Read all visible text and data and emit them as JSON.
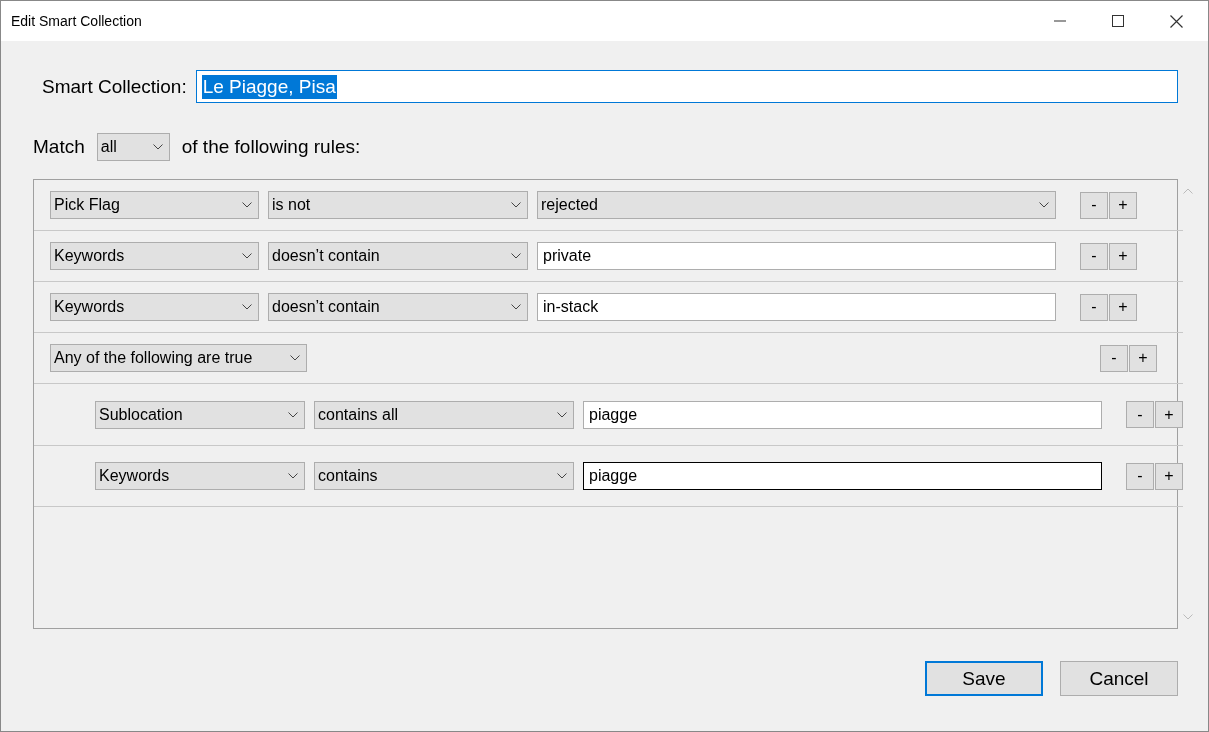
{
  "window": {
    "title": "Edit Smart Collection"
  },
  "name_field": {
    "label": "Smart Collection:",
    "value": "Le Piagge, Pisa",
    "text_selected": true
  },
  "match": {
    "label": "Match",
    "value": "all",
    "suffix": "of the following rules:"
  },
  "rules": [
    {
      "kind": "rule",
      "field": "Pick Flag",
      "operator": "is not",
      "value": {
        "kind": "dropdown",
        "text": "rejected"
      },
      "remove": "-",
      "add": "+"
    },
    {
      "kind": "rule",
      "field": "Keywords",
      "operator": "doesn’t contain",
      "value": {
        "kind": "text",
        "text": "private",
        "focused": false
      },
      "remove": "-",
      "add": "+"
    },
    {
      "kind": "rule",
      "field": "Keywords",
      "operator": "doesn’t contain",
      "value": {
        "kind": "text",
        "text": "in-stack",
        "focused": false
      },
      "remove": "-",
      "add": "+"
    },
    {
      "kind": "group",
      "field": "Any of the following are true",
      "remove": "-",
      "add": "+",
      "children": [
        {
          "kind": "rule",
          "field": "Sublocation",
          "operator": "contains all",
          "value": {
            "kind": "text",
            "text": "piagge",
            "focused": false
          },
          "remove": "-",
          "add": "+"
        },
        {
          "kind": "rule",
          "field": "Keywords",
          "operator": "contains",
          "value": {
            "kind": "text",
            "text": "piagge",
            "focused": true
          },
          "remove": "-",
          "add": "+"
        }
      ]
    }
  ],
  "buttons": [
    {
      "label": "Save",
      "default": true
    },
    {
      "label": "Cancel",
      "default": false
    }
  ]
}
